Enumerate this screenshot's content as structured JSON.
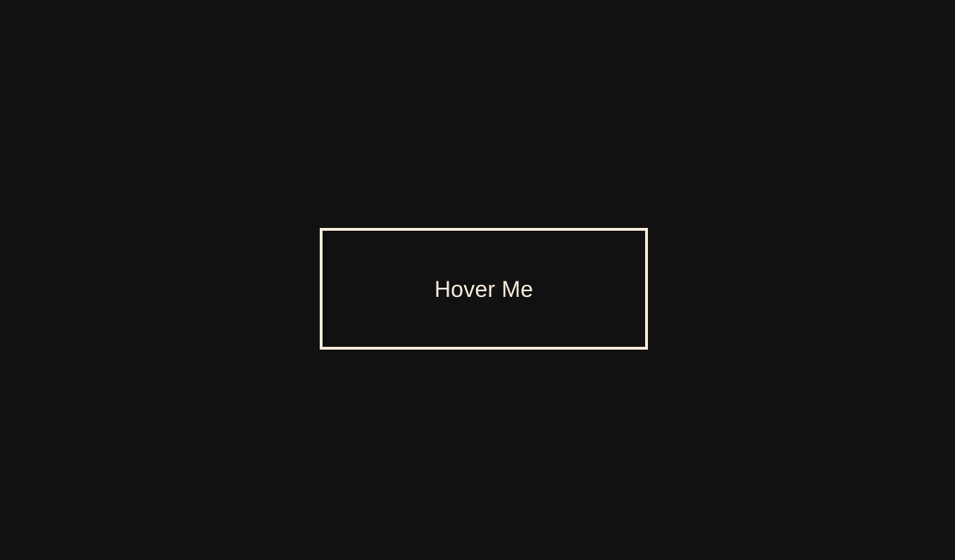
{
  "colors": {
    "background": "#111111",
    "accent": "#f8ecdd"
  },
  "button": {
    "label": "Hover Me"
  }
}
